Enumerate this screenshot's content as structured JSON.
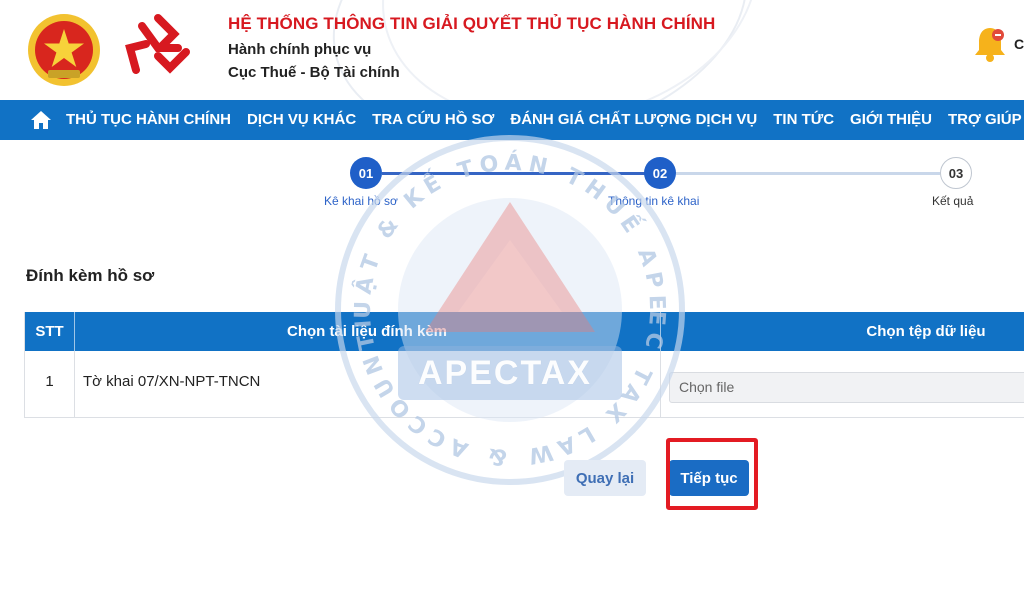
{
  "header": {
    "title": "HỆ THỐNG THÔNG TIN GIẢI QUYẾT THỦ TỤC HÀNH CHÍNH",
    "subtitle1": "Hành chính phục vụ",
    "subtitle2": "Cục Thuế - Bộ Tài chính",
    "user_initial": "C"
  },
  "nav": {
    "items": [
      "THỦ TỤC HÀNH CHÍNH",
      "DỊCH VỤ KHÁC",
      "TRA CỨU HỒ SƠ",
      "ĐÁNH GIÁ CHẤT LƯỢNG DỊCH VỤ",
      "TIN TỨC",
      "GIỚI THIỆU",
      "TRỢ GIÚP"
    ]
  },
  "stepper": {
    "steps": [
      {
        "number": "01",
        "label": "Kê khai hồ sơ",
        "state": "done"
      },
      {
        "number": "02",
        "label": "Thông tin kê khai",
        "state": "active"
      },
      {
        "number": "03",
        "label": "Kết quả",
        "state": "pending"
      }
    ]
  },
  "section": {
    "title": "Đính kèm hồ sơ"
  },
  "table": {
    "headers": [
      "STT",
      "Chọn tài liệu đính kèm",
      "Chọn tệp dữ liệu"
    ],
    "rows": [
      {
        "stt": "1",
        "document": "Tờ khai 07/XN-NPT-TNCN",
        "file_placeholder": "Chọn file"
      }
    ]
  },
  "buttons": {
    "back": "Quay lại",
    "next": "Tiếp tục"
  },
  "watermark": {
    "brand": "APECTAX",
    "ring_text_top": "LUẬT & KẾ TOÁN THUẾ APEC",
    "ring_text_bottom": "APEC TAX LAW & ACCOUNTING"
  },
  "colors": {
    "nav_bg": "#1172c5",
    "title_red": "#d71920",
    "primary": "#1a6cc4",
    "highlight": "#e31b23"
  }
}
